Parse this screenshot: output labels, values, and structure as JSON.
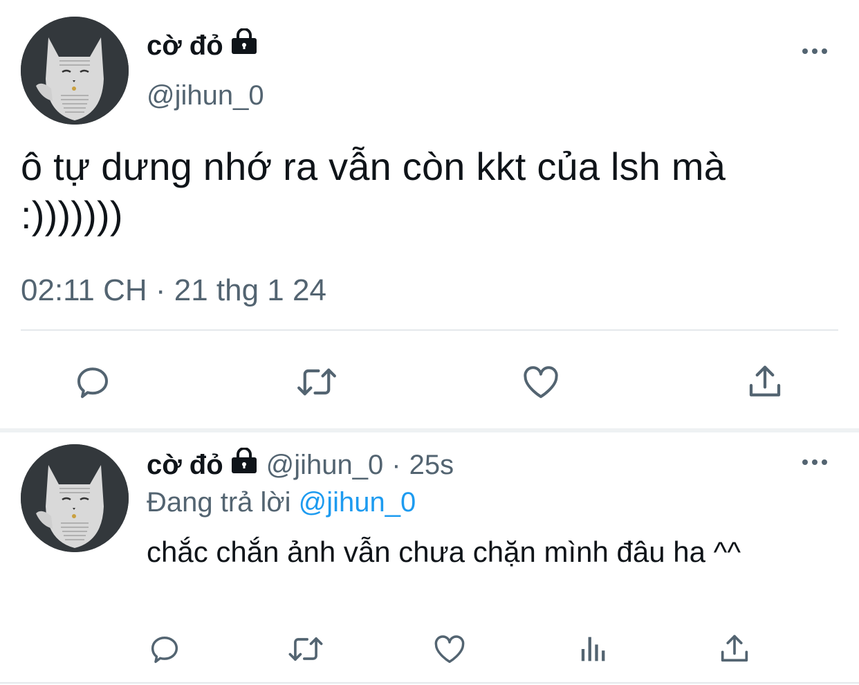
{
  "main_tweet": {
    "display_name": "cờ đỏ",
    "handle": "@jihun_0",
    "text": "ô tự dưng nhớ ra vẫn còn kkt của lsh mà :)))))))",
    "time": "02:11 CH",
    "separator": "·",
    "date": "21 thg 1 24",
    "actions": [
      "reply-icon",
      "retweet-icon",
      "like-icon",
      "share-icon"
    ]
  },
  "reply_tweet": {
    "display_name": "cờ đỏ",
    "handle": "@jihun_0",
    "separator": "·",
    "time_ago": "25s",
    "replying_prefix": "Đang trả lời",
    "replying_to": "@jihun_0",
    "text": "chắc chắn ảnh vẫn chưa chặn mình đâu ha ^^",
    "actions": [
      "reply-icon",
      "retweet-icon",
      "like-icon",
      "analytics-icon",
      "share-icon"
    ]
  },
  "colors": {
    "text_primary": "#0f1419",
    "text_secondary": "#536471",
    "link": "#1d9bf0",
    "divider": "#e4e8eb"
  }
}
